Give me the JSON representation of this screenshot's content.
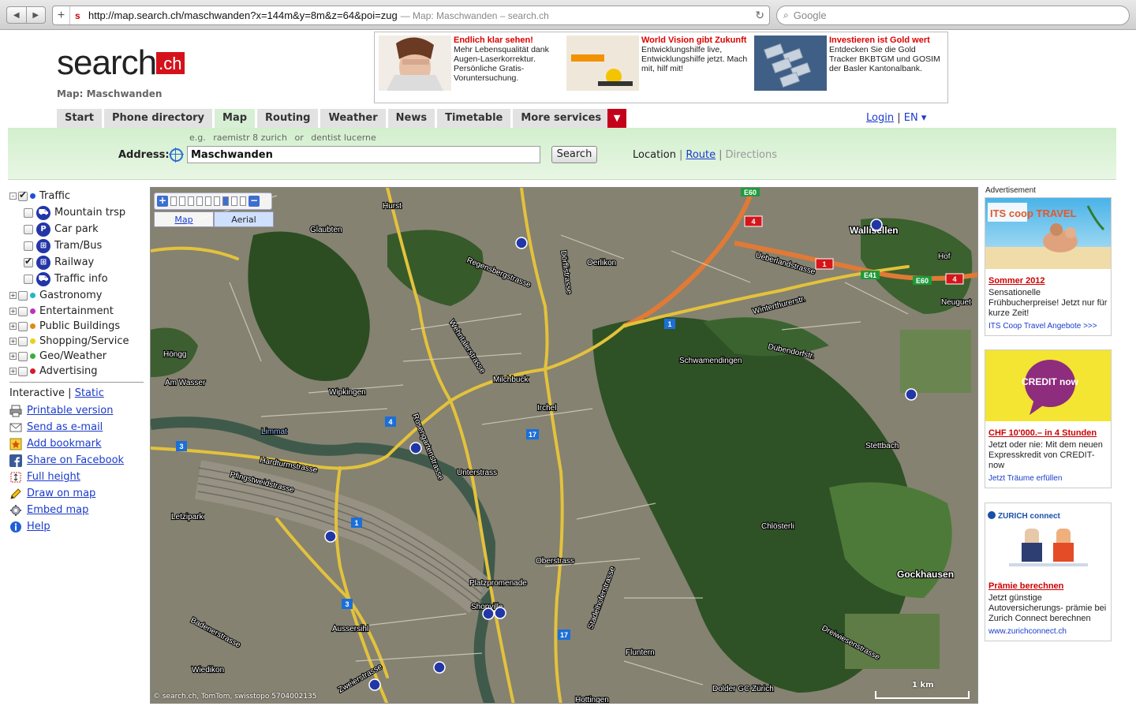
{
  "browser": {
    "url": "http://map.search.ch/maschwanden?x=144m&y=8m&z=64&poi=zug",
    "page_title": "— Map: Maschwanden – search.ch",
    "search_placeholder": "Google"
  },
  "header": {
    "logo_text": "search",
    "logo_suffix": ".ch",
    "map_label": "Map: Maschwanden"
  },
  "top_ads": [
    {
      "headline": "Endlich klar sehen!",
      "text": "Mehr Lebensqualität dank Augen-Laserkorrektur. Persönliche Gratis-Voruntersuchung."
    },
    {
      "headline": "World Vision gibt Zukunft",
      "text": "Entwicklungshilfe live, Entwicklungshilfe jetzt. Mach mit, hilf mit!"
    },
    {
      "headline": "Investieren ist Gold wert",
      "text": "Entdecken Sie die Gold Tracker BKBTGM und GOSIM der Basler Kantonalbank."
    }
  ],
  "tabs": [
    "Start",
    "Phone directory",
    "Map",
    "Routing",
    "Weather",
    "News",
    "Timetable",
    "More services"
  ],
  "active_tab": "Map",
  "account": {
    "login": "Login",
    "separator": "|",
    "language": "EN ▾"
  },
  "address": {
    "example_prefix": "e.g.",
    "example1": "raemistr 8 zurich",
    "example_or": "or",
    "example2": "dentist lucerne",
    "label": "Address:",
    "value": "Maschwanden",
    "search_button": "Search",
    "mode_location": "Location",
    "mode_route": "Route",
    "mode_directions": "Directions"
  },
  "layers": {
    "traffic": {
      "label": "Traffic",
      "checked": true,
      "color": "#1f4fd6",
      "children": [
        {
          "label": "Mountain trsp",
          "icon": "M",
          "checked": false
        },
        {
          "label": "Car park",
          "icon": "P",
          "checked": false
        },
        {
          "label": "Tram/Bus",
          "icon": "T",
          "checked": false
        },
        {
          "label": "Railway",
          "icon": "R",
          "checked": true
        },
        {
          "label": "Traffic info",
          "icon": "i",
          "checked": false
        }
      ]
    },
    "groups": [
      {
        "label": "Gastronomy",
        "color": "#23b6c9"
      },
      {
        "label": "Entertainment",
        "color": "#c030c0"
      },
      {
        "label": "Public Buildings",
        "color": "#e08a18"
      },
      {
        "label": "Shopping/Service",
        "color": "#e8d21c"
      },
      {
        "label": "Geo/Weather",
        "color": "#38b038"
      },
      {
        "label": "Advertising",
        "color": "#d81a2a"
      }
    ]
  },
  "view_mode": {
    "interactive": "Interactive",
    "static": "Static"
  },
  "tools": [
    {
      "label": "Printable version",
      "icon": "printer-icon"
    },
    {
      "label": "Send as e-mail",
      "icon": "mail-icon"
    },
    {
      "label": "Add bookmark",
      "icon": "bookmark-icon"
    },
    {
      "label": "Share on Facebook",
      "icon": "facebook-icon"
    },
    {
      "label": "Full height",
      "icon": "fullheight-icon"
    },
    {
      "label": "Draw on map",
      "icon": "pencil-icon"
    },
    {
      "label": "Embed map",
      "icon": "embed-icon"
    },
    {
      "label": "Help",
      "icon": "help-icon"
    }
  ],
  "map": {
    "type_map": "Map",
    "type_aerial": "Aerial",
    "copyright": "© search.ch, TomTom, swisstopo 5704002135",
    "scale": "1 km",
    "place_labels": [
      "Hurst",
      "Glaubten",
      "Wallisellen",
      "Oerlikon",
      "Hof",
      "Neuguet",
      "Höngg",
      "Am Wasser",
      "Wipkingen",
      "Milchbuck",
      "Irchel",
      "Schwamendingen",
      "Limmat",
      "Unterstrass",
      "Letzipark",
      "Stettbach",
      "Chlösterli",
      "Gockhausen",
      "Oberstrass",
      "Platzpromenade",
      "Aussersihl",
      "Shopville",
      "Wiedikon",
      "Fluntern",
      "Dolder GC Zürich",
      "Hottingen",
      "Dübendorfstr.",
      "Winterthurerstr.",
      "Hardturmstrasse",
      "Pfingstweidstrasse",
      "Regensbergstrasse",
      "Wehntalerstrasse",
      "Rosengartenstrasse",
      "Dörflistrasse",
      "Ueberlandstrasse",
      "Dreiwiesenstrasse",
      "Stadelhoferstrasse",
      "Zweierstrasse",
      "Badenerstrasse"
    ],
    "road_badges": [
      "E60",
      "4",
      "1",
      "E41",
      "E60",
      "4",
      "3",
      "4",
      "1",
      "3",
      "17",
      "17",
      "1"
    ]
  },
  "right_ads": {
    "label": "Advertisement",
    "items": [
      {
        "headline": "Sommer 2012",
        "text": "Sensationelle Frühbucherpreise! Jetzt nur für kurze Zeit!",
        "link": "ITS Coop Travel Angebote >>>"
      },
      {
        "headline": "CHF 10'000.– in 4 Stunden",
        "text": "Jetzt oder nie: Mit dem neuen Expresskredit von CREDIT-now",
        "link": "Jetzt Träume erfüllen"
      },
      {
        "headline": "Prämie berechnen",
        "text": "Jetzt günstige Autoversicherungs- prämie bei Zurich Connect berechnen",
        "link": "www.zurichconnect.ch"
      }
    ],
    "banner_texts": [
      "ITS coop TRAVEL",
      "CREDIT now",
      "ZURICH connect"
    ]
  }
}
